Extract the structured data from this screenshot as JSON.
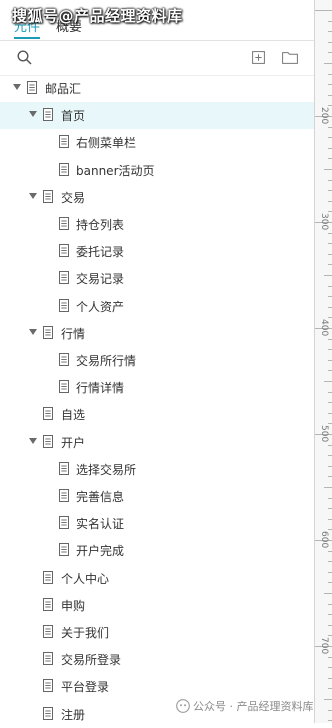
{
  "watermark_top": "搜狐号@产品经理资料库",
  "watermark_bottom": "公众号 · 产品经理资料库",
  "tabs": {
    "active": "元件",
    "second": "概要"
  },
  "ruler": {
    "labels": [
      "200",
      "300",
      "400",
      "500",
      "600",
      "700"
    ]
  },
  "colors": {
    "accent": "#1a9cb7",
    "selected_bg": "#e8f8fa"
  },
  "icons": {
    "search": "search-icon",
    "add_page": "add-page-icon",
    "folder": "folder-icon",
    "page": "page-icon"
  },
  "tree": [
    {
      "label": "邮品汇",
      "level": 0,
      "expanded": true
    },
    {
      "label": "首页",
      "level": 1,
      "expanded": true,
      "selected": true
    },
    {
      "label": "右侧菜单栏",
      "level": 2
    },
    {
      "label": "banner活动页",
      "level": 2
    },
    {
      "label": "交易",
      "level": 1,
      "expanded": true
    },
    {
      "label": "持仓列表",
      "level": 2
    },
    {
      "label": "委托记录",
      "level": 2
    },
    {
      "label": "交易记录",
      "level": 2
    },
    {
      "label": "个人资产",
      "level": 2
    },
    {
      "label": "行情",
      "level": 1,
      "expanded": true
    },
    {
      "label": "交易所行情",
      "level": 2
    },
    {
      "label": "行情详情",
      "level": 2
    },
    {
      "label": "自选",
      "level": 1
    },
    {
      "label": "开户",
      "level": 1,
      "expanded": true
    },
    {
      "label": "选择交易所",
      "level": 2
    },
    {
      "label": "完善信息",
      "level": 2
    },
    {
      "label": "实名认证",
      "level": 2
    },
    {
      "label": "开户完成",
      "level": 2
    },
    {
      "label": "个人中心",
      "level": 1
    },
    {
      "label": "申购",
      "level": 1
    },
    {
      "label": "关于我们",
      "level": 1
    },
    {
      "label": "交易所登录",
      "level": 1
    },
    {
      "label": "平台登录",
      "level": 1
    },
    {
      "label": "注册",
      "level": 1
    }
  ]
}
